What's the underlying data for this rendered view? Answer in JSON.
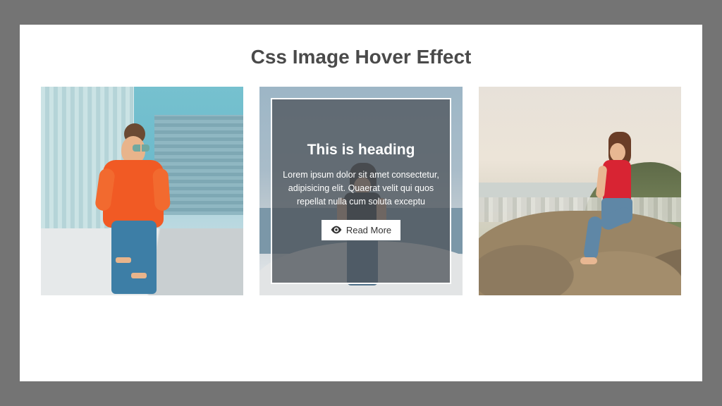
{
  "page": {
    "title": "Css Image Hover Effect"
  },
  "cards": [
    {
      "alt": "Woman in orange T-shirt and jeans on rooftop"
    },
    {
      "alt": "Woman in black top by the sea",
      "overlay": {
        "heading": "This is heading",
        "text": "Lorem ipsum dolor sit amet consectetur, adipisicing elit. Quaerat velit qui quos repellat nulla cum soluta exceptu",
        "button_label": "Read More",
        "button_icon": "eye-icon"
      }
    },
    {
      "alt": "Woman in red top sitting on coastal rocks"
    }
  ]
}
